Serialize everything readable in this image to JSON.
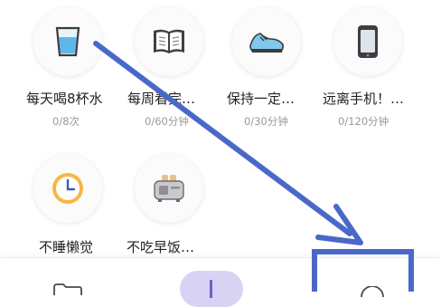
{
  "colors": {
    "annotation": "#4a68c8",
    "subtext": "#9a9a9a",
    "fab": "#d8d3f2"
  },
  "habits": [
    {
      "title": "每天喝8杯水",
      "progress": "0/8次",
      "icon": "water-glass-icon"
    },
    {
      "title": "每周看完…",
      "progress": "0/60分钟",
      "icon": "book-icon"
    },
    {
      "title": "保持一定…",
      "progress": "0/30分钟",
      "icon": "running-shoe-icon"
    },
    {
      "title": "远离手机！…",
      "progress": "0/120分钟",
      "icon": "phone-icon"
    },
    {
      "title": "不睡懒觉",
      "progress": "",
      "icon": "clock-icon"
    },
    {
      "title": "不吃早饭…",
      "progress": "",
      "icon": "toaster-icon"
    }
  ],
  "bottom_nav": {
    "items": [
      "folder-icon",
      "add-icon",
      "circle-icon"
    ]
  }
}
